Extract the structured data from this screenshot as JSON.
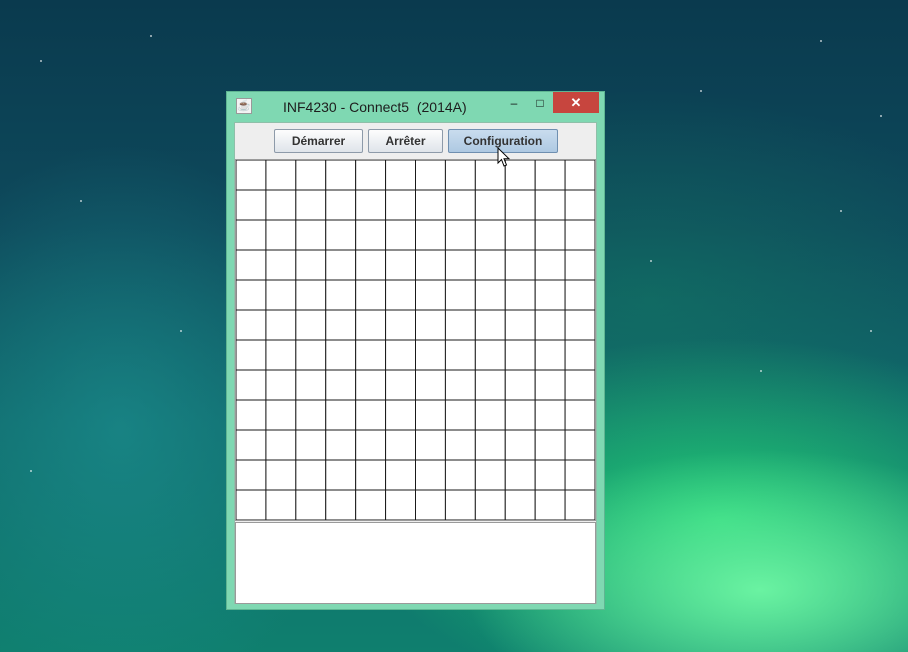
{
  "window": {
    "title": "INF4230 - Connect5  (2014A)",
    "app_icon": "java-icon",
    "controls": {
      "minimize": "–",
      "maximize": "□",
      "close": "✕"
    }
  },
  "toolbar": {
    "buttons": [
      {
        "label": "Démarrer"
      },
      {
        "label": "Arrêter"
      },
      {
        "label": "Configuration",
        "state": "hovered"
      }
    ]
  },
  "board": {
    "rows": 12,
    "columns": 12,
    "cells_empty": true
  },
  "output": {
    "text": ""
  },
  "colors": {
    "titlebar": "#7fd8b2",
    "close_button": "#c7453e",
    "client_background": "#eeeeee",
    "grid_line": "#1a1a1a"
  }
}
